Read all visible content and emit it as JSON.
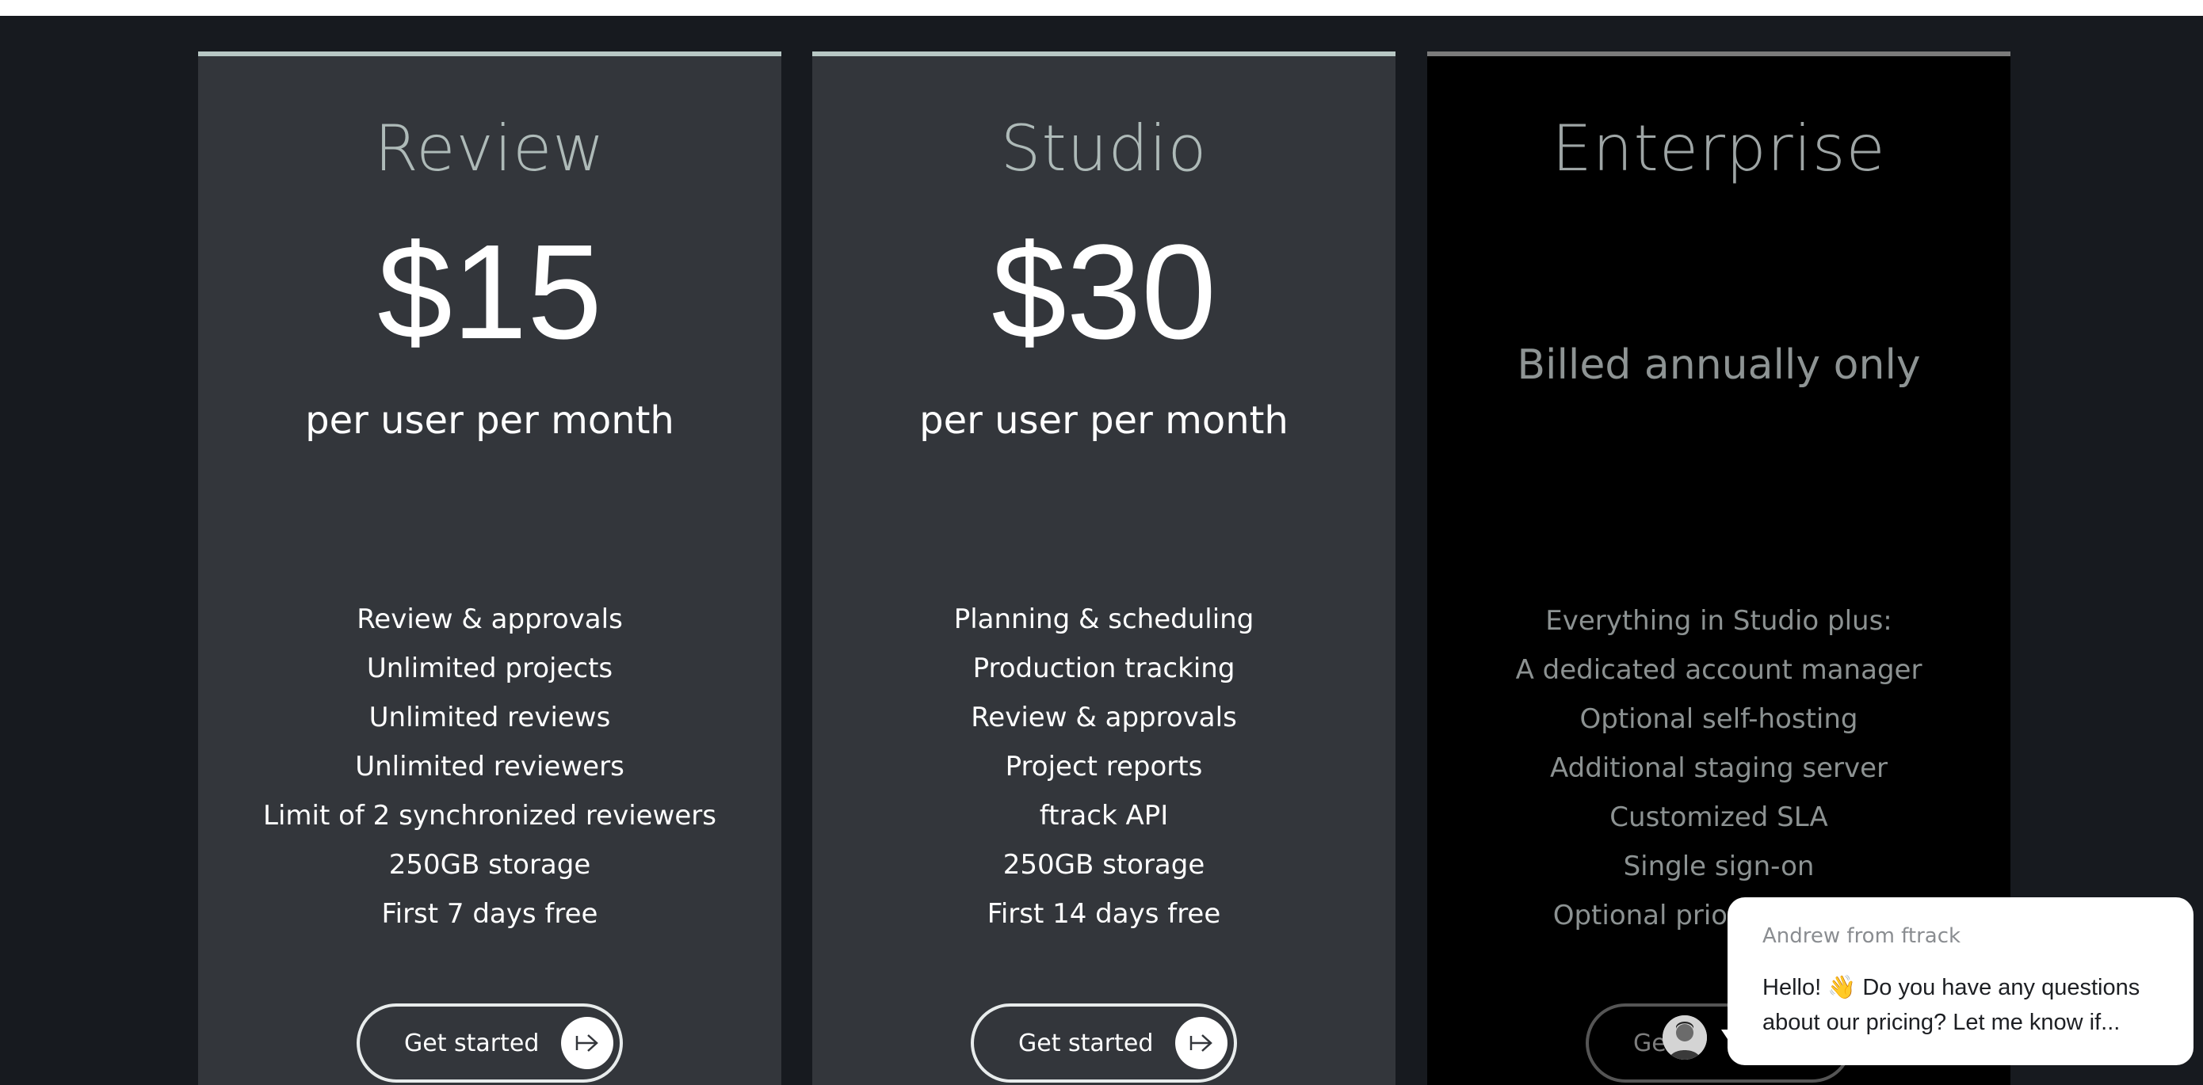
{
  "plans": [
    {
      "title": "Review",
      "price": "$15",
      "price_sub": "per user per month",
      "features": [
        "Review & approvals",
        "Unlimited projects",
        "Unlimited reviews",
        "Unlimited reviewers",
        "Limit of 2 synchronized reviewers",
        "250GB storage",
        "First 7 days free"
      ],
      "button": "Get started"
    },
    {
      "title": "Studio",
      "price": "$30",
      "price_sub": "per user per month",
      "features": [
        "Planning & scheduling",
        "Production tracking",
        "Review & approvals",
        "Project reports",
        "ftrack API",
        "250GB storage",
        "First 14 days free"
      ],
      "button": "Get started"
    },
    {
      "title": "Enterprise",
      "billing_note": "Billed annually only",
      "features": [
        "Everything in Studio plus:",
        "A dedicated account manager",
        "Optional self-hosting",
        "Additional staging server",
        "Customized SLA",
        "Single sign-on",
        "Optional priority support"
      ],
      "button_visible": "Ge          rt"
    }
  ],
  "chat": {
    "from": "Andrew from ftrack",
    "message": "Hello! 👋 Do you have any questions about our pricing? Let me know if..."
  },
  "icons": {
    "button_arrow": "arrow-right-icon",
    "chat_avatar": "avatar"
  },
  "colors": {
    "page_bg": "#171a1f",
    "card_bg": "#33363b",
    "enterprise_bg": "#000000",
    "accent_border": "#b8c7c4"
  }
}
